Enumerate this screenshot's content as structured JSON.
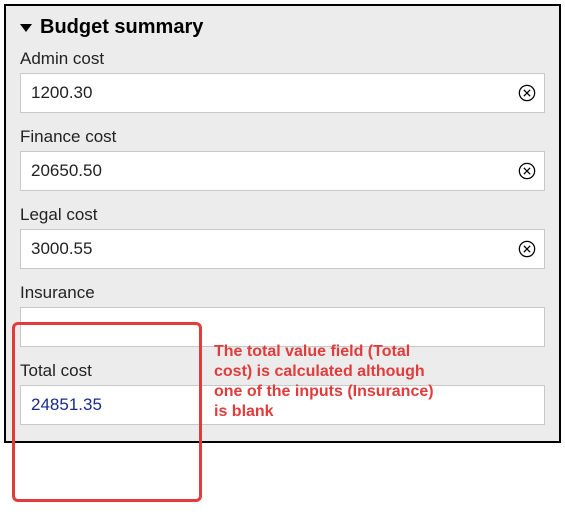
{
  "header": {
    "title": "Budget summary"
  },
  "fields": {
    "admin": {
      "label": "Admin cost",
      "value": "1200.30"
    },
    "finance": {
      "label": "Finance cost",
      "value": "20650.50"
    },
    "legal": {
      "label": "Legal cost",
      "value": "3000.55"
    },
    "insurance": {
      "label": "Insurance",
      "value": ""
    },
    "total": {
      "label": "Total cost",
      "value": "24851.35"
    }
  },
  "annotation": {
    "text": "The total value field (Total cost) is calculated although one of the inputs (Insurance) is blank"
  },
  "colors": {
    "highlight": "#e23b3b",
    "total_text": "#1a2a8a",
    "panel_bg": "#ececec"
  }
}
